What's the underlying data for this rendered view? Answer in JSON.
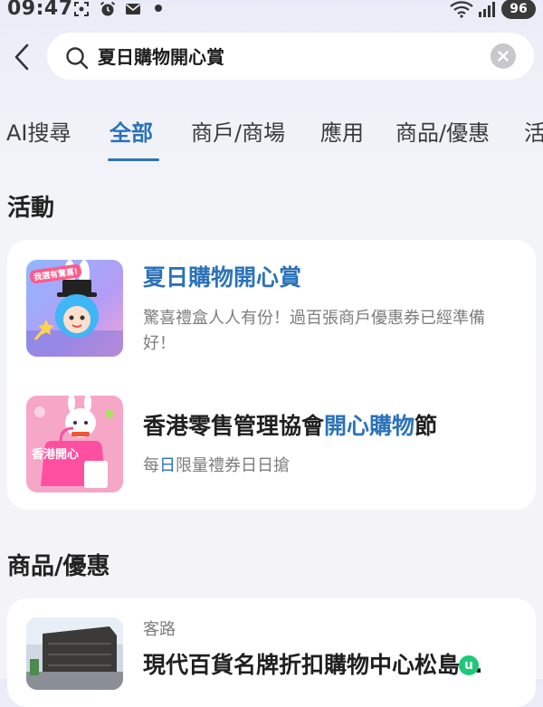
{
  "status_bar": {
    "time": "09:47",
    "battery": "96"
  },
  "search": {
    "query": "夏日購物開心賞"
  },
  "tabs": [
    "AI搜尋",
    "全部",
    "商戶/商場",
    "應用",
    "商品/優惠",
    "活"
  ],
  "sections": {
    "activities": {
      "title": "活動",
      "items": [
        {
          "title": "夏日購物開心賞",
          "desc": "驚喜禮盒人人有份！過百張商戶優惠券已經準備好！",
          "badge_text": "我選有驚喜!"
        },
        {
          "title_prefix": "香港零售管理協會",
          "title_highlight": "開心購物",
          "title_suffix": "節",
          "desc_prefix": "每",
          "desc_highlight": "日",
          "desc_suffix": "限量禮券日日搶",
          "badge_text": "香港開心"
        }
      ]
    },
    "products": {
      "title": "商品/優惠",
      "items": [
        {
          "category": "客路",
          "title": "現代百貨名牌折扣購物中心松島…"
        }
      ]
    }
  },
  "colors": {
    "accent": "#2b72b8",
    "card": "#ffffff",
    "muted": "#7d7d7d"
  }
}
